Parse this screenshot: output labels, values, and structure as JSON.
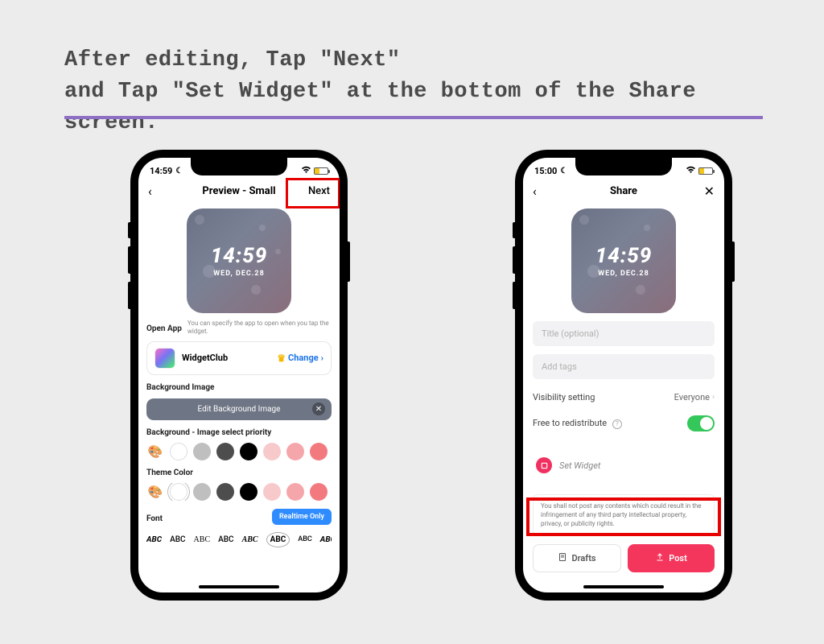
{
  "heading_line1": "After editing, Tap \"Next\"",
  "heading_line2": "and Tap \"Set Widget\" at the bottom of the Share screen.",
  "phone_left": {
    "status_time": "14:59",
    "nav_title": "Preview - Small",
    "nav_next": "Next",
    "widget_time": "14:59",
    "widget_date": "WED, DEC.28",
    "open_app_label": "Open App",
    "open_app_desc": "You can specify the app to open when you tap the widget.",
    "app_name": "WidgetClub",
    "change_label": "Change",
    "bg_image_label": "Background Image",
    "edit_bg_button": "Edit Background Image",
    "bg_priority_label": "Background - Image select priority",
    "theme_color_label": "Theme Color",
    "font_label": "Font",
    "realtime_button": "Realtime Only",
    "font_sample": "ABC"
  },
  "phone_right": {
    "status_time": "15:00",
    "nav_title": "Share",
    "widget_time": "14:59",
    "widget_date": "WED, DEC.28",
    "title_placeholder": "Title (optional)",
    "tags_placeholder": "Add tags",
    "visibility_label": "Visibility setting",
    "visibility_value": "Everyone",
    "redistribute_label": "Free to redistribute",
    "set_widget_label": "Set Widget",
    "disclaimer": "You shall not post any contents which could result in the infringement of any third party intellectual property, privacy, or publicity rights.",
    "drafts_label": "Drafts",
    "post_label": "Post"
  }
}
